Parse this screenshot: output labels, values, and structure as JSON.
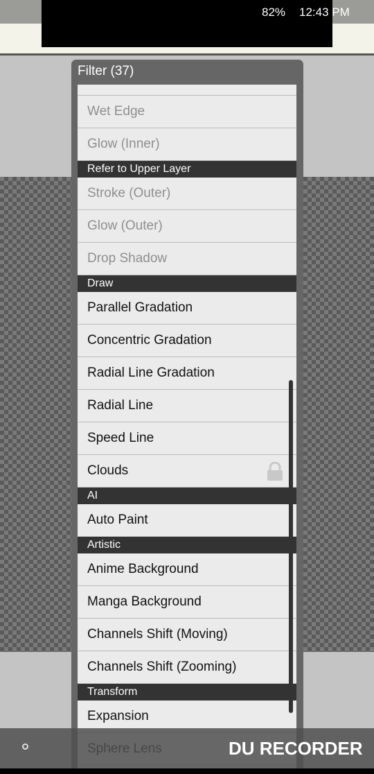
{
  "status_bar": {
    "battery": "82%",
    "time": "12:43 PM"
  },
  "dialog": {
    "title": "Filter (37)"
  },
  "list": [
    {
      "type": "item",
      "label": "",
      "disabled": true
    },
    {
      "type": "item",
      "label": "Wet Edge",
      "disabled": true
    },
    {
      "type": "item",
      "label": "Glow (Inner)",
      "disabled": true
    },
    {
      "type": "header",
      "label": "Refer to Upper Layer"
    },
    {
      "type": "item",
      "label": "Stroke (Outer)",
      "disabled": true
    },
    {
      "type": "item",
      "label": "Glow (Outer)",
      "disabled": true
    },
    {
      "type": "item",
      "label": "Drop Shadow",
      "disabled": true
    },
    {
      "type": "header",
      "label": "Draw"
    },
    {
      "type": "item",
      "label": "Parallel Gradation"
    },
    {
      "type": "item",
      "label": "Concentric Gradation"
    },
    {
      "type": "item",
      "label": "Radial Line Gradation"
    },
    {
      "type": "item",
      "label": "Radial Line"
    },
    {
      "type": "item",
      "label": "Speed Line"
    },
    {
      "type": "item",
      "label": "Clouds",
      "locked": true
    },
    {
      "type": "header",
      "label": "AI"
    },
    {
      "type": "item",
      "label": "Auto Paint"
    },
    {
      "type": "header",
      "label": "Artistic"
    },
    {
      "type": "item",
      "label": "Anime Background"
    },
    {
      "type": "item",
      "label": "Manga Background"
    },
    {
      "type": "item",
      "label": "Channels Shift (Moving)"
    },
    {
      "type": "item",
      "label": "Channels Shift (Zooming)"
    },
    {
      "type": "header",
      "label": "Transform"
    },
    {
      "type": "item",
      "label": "Expansion"
    },
    {
      "type": "item",
      "label": "Sphere Lens"
    }
  ],
  "watermark": "DU RECORDER"
}
